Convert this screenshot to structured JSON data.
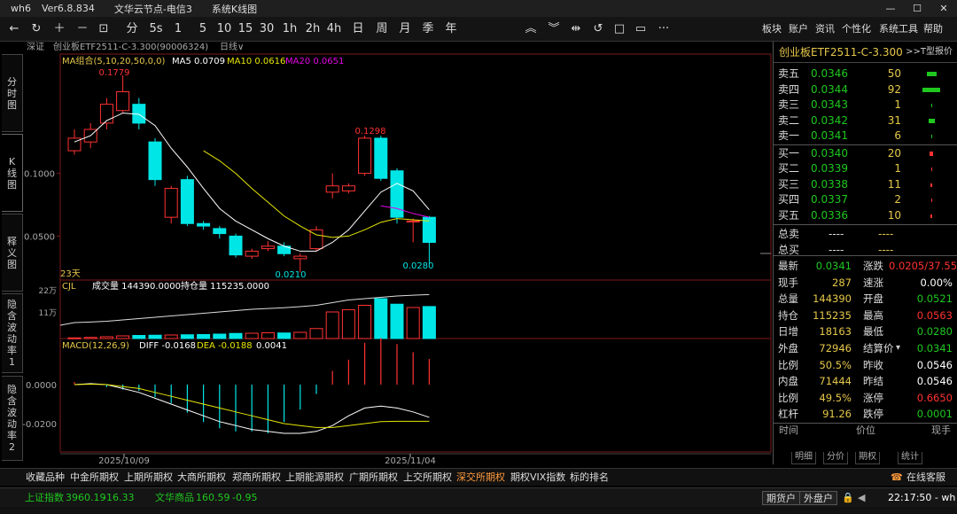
{
  "titlebar": {
    "app": "wh6",
    "version": "Ver6.8.834",
    "node": "文华云节点-电信3",
    "section": "系统K线图"
  },
  "toolbar": {
    "periods": [
      "分",
      "5s",
      "1",
      "5",
      "10",
      "15",
      "30",
      "1h",
      "2h",
      "4h",
      "日",
      "周",
      "月",
      "季",
      "年"
    ],
    "menus": [
      "板块",
      "账户",
      "资讯",
      "个性化",
      "系统工具",
      "帮助"
    ]
  },
  "subheader": {
    "exchange": "深证",
    "instrument": "创业板ETF2511-C-3.300(90006324)",
    "period": "日线"
  },
  "lefttabs": [
    [
      "分",
      "时",
      "图"
    ],
    [
      "K",
      "线",
      "图"
    ],
    [
      "释",
      "义",
      "图"
    ],
    [
      "隐",
      "含",
      "波",
      "动",
      "率",
      "1"
    ],
    [
      "隐",
      "含",
      "波",
      "动",
      "率",
      "2"
    ]
  ],
  "main_chart": {
    "ma_label": "MA组合(5,10,20,50,0,0)",
    "ma5": "MA5 0.0709",
    "ma10": "MA10 0.0616",
    "ma20": "MA20 0.0651",
    "y_ticks": [
      "0.1000",
      "0.0500"
    ],
    "high_label": "0.1779",
    "high2_label": "0.1298",
    "low_label": "0.0210",
    "last_low_label": "0.0280",
    "days_label": "23天",
    "colors": {
      "up": "#ff3232",
      "down": "#00e6e6",
      "ma5": "#ffffff",
      "ma10": "#e6e600",
      "ma20": "#e600e6"
    }
  },
  "volume_chart": {
    "title": "CJL",
    "vol": "成交量 144390.0000",
    "oi": "持仓量 115235.0000",
    "y_ticks": [
      "22万",
      "11万"
    ]
  },
  "macd_chart": {
    "title": "MACD(12,26,9)",
    "diff": "DIFF -0.0168",
    "dea": "DEA -0.0188",
    "macd": "0.0041",
    "y_ticks": [
      "0.0000",
      "-0.0200"
    ],
    "x_dates": [
      "2025/10/09",
      "2025/11/04"
    ]
  },
  "chart_data": {
    "type": "candlestick",
    "title": "创业板ETF2511-C-3.300 日线",
    "series": [
      {
        "name": "candles",
        "values": [
          {
            "o": 0.118,
            "c": 0.128,
            "h": 0.135,
            "l": 0.115
          },
          {
            "o": 0.125,
            "c": 0.135,
            "h": 0.14,
            "l": 0.12
          },
          {
            "o": 0.14,
            "c": 0.155,
            "h": 0.16,
            "l": 0.135
          },
          {
            "o": 0.15,
            "c": 0.165,
            "h": 0.178,
            "l": 0.148
          },
          {
            "o": 0.155,
            "c": 0.14,
            "h": 0.16,
            "l": 0.135
          },
          {
            "o": 0.125,
            "c": 0.095,
            "h": 0.128,
            "l": 0.09
          },
          {
            "o": 0.065,
            "c": 0.088,
            "h": 0.09,
            "l": 0.06
          },
          {
            "o": 0.095,
            "c": 0.06,
            "h": 0.098,
            "l": 0.058
          },
          {
            "o": 0.06,
            "c": 0.058,
            "h": 0.062,
            "l": 0.055
          },
          {
            "o": 0.056,
            "c": 0.052,
            "h": 0.058,
            "l": 0.048
          },
          {
            "o": 0.05,
            "c": 0.035,
            "h": 0.052,
            "l": 0.033
          },
          {
            "o": 0.034,
            "c": 0.038,
            "h": 0.04,
            "l": 0.032
          },
          {
            "o": 0.04,
            "c": 0.042,
            "h": 0.046,
            "l": 0.038
          },
          {
            "o": 0.042,
            "c": 0.036,
            "h": 0.045,
            "l": 0.034
          },
          {
            "o": 0.032,
            "c": 0.034,
            "h": 0.036,
            "l": 0.021
          },
          {
            "o": 0.04,
            "c": 0.055,
            "h": 0.058,
            "l": 0.038
          },
          {
            "o": 0.085,
            "c": 0.09,
            "h": 0.1,
            "l": 0.08
          },
          {
            "o": 0.086,
            "c": 0.09,
            "h": 0.092,
            "l": 0.084
          },
          {
            "o": 0.1,
            "c": 0.128,
            "h": 0.13,
            "l": 0.098
          },
          {
            "o": 0.128,
            "c": 0.096,
            "h": 0.13,
            "l": 0.094
          },
          {
            "o": 0.102,
            "c": 0.065,
            "h": 0.104,
            "l": 0.06
          },
          {
            "o": 0.062,
            "c": 0.062,
            "h": 0.064,
            "l": 0.045
          },
          {
            "o": 0.065,
            "c": 0.045,
            "h": 0.066,
            "l": 0.028
          }
        ]
      },
      {
        "name": "MA5",
        "values": [
          0.125,
          0.13,
          0.142,
          0.148,
          0.147,
          0.138,
          0.12,
          0.105,
          0.088,
          0.072,
          0.062,
          0.055,
          0.048,
          0.042,
          0.038,
          0.038,
          0.045,
          0.055,
          0.07,
          0.085,
          0.092,
          0.086,
          0.071
        ]
      },
      {
        "name": "MA10",
        "values": [
          null,
          null,
          null,
          null,
          null,
          null,
          null,
          null,
          0.118,
          0.11,
          0.1,
          0.088,
          0.077,
          0.066,
          0.058,
          0.051,
          0.049,
          0.05,
          0.055,
          0.061,
          0.064,
          0.063,
          0.062
        ]
      },
      {
        "name": "MA20",
        "values": [
          null,
          null,
          null,
          null,
          null,
          null,
          null,
          null,
          null,
          null,
          null,
          null,
          null,
          null,
          null,
          null,
          null,
          null,
          null,
          0.074,
          0.072,
          0.068,
          0.065
        ]
      }
    ],
    "volume": [
      3000,
      5000,
      8000,
      12000,
      14000,
      15000,
      16000,
      17000,
      18000,
      20000,
      23000,
      24000,
      26000,
      25000,
      28000,
      45000,
      120000,
      130000,
      150000,
      180000,
      155000,
      140000,
      144390
    ],
    "open_interest": [
      10000,
      12000,
      15000,
      20000,
      25000,
      30000,
      35000,
      40000,
      45000,
      50000,
      55000,
      60000,
      63000,
      66000,
      70000,
      75000,
      85000,
      95000,
      100000,
      105000,
      110000,
      113000,
      115235
    ],
    "macd_hist": [
      0.0004,
      0.0002,
      -0.0004,
      -0.0008,
      -0.001,
      -0.002,
      -0.003,
      -0.0045,
      -0.006,
      -0.007,
      -0.0075,
      -0.0075,
      -0.0078,
      -0.006,
      -0.004,
      -0.0015,
      0.0022,
      0.004,
      0.0067,
      0.0075,
      0.0065,
      0.0052,
      0.0041
    ],
    "diff": [
      0.0,
      0.0005,
      0.0,
      -0.002,
      -0.004,
      -0.007,
      -0.01,
      -0.013,
      -0.016,
      -0.019,
      -0.021,
      -0.023,
      -0.024,
      -0.025,
      -0.025,
      -0.024,
      -0.021,
      -0.016,
      -0.012,
      -0.011,
      -0.012,
      -0.014,
      -0.0168
    ],
    "dea": [
      0.0,
      0.0002,
      0.0,
      -0.001,
      -0.002,
      -0.004,
      -0.006,
      -0.008,
      -0.01,
      -0.012,
      -0.014,
      -0.016,
      -0.018,
      -0.02,
      -0.021,
      -0.022,
      -0.022,
      -0.021,
      -0.02,
      -0.019,
      -0.0188,
      -0.0188,
      -0.0188
    ],
    "ylim": [
      0.015,
      0.195
    ]
  },
  "rpanel": {
    "title": "创业板ETF2511-C-3.300",
    "tinfo": ">>T型报价",
    "sells": [
      {
        "lbl": "卖五",
        "pr": "0.0346",
        "vol": "50",
        "w": 11
      },
      {
        "lbl": "卖四",
        "pr": "0.0344",
        "vol": "92",
        "w": 20
      },
      {
        "lbl": "卖三",
        "pr": "0.0343",
        "vol": "1",
        "w": 1
      },
      {
        "lbl": "卖二",
        "pr": "0.0342",
        "vol": "31",
        "w": 7
      },
      {
        "lbl": "卖一",
        "pr": "0.0341",
        "vol": "6",
        "w": 1
      }
    ],
    "buys": [
      {
        "lbl": "买一",
        "pr": "0.0340",
        "vol": "20",
        "w": 4
      },
      {
        "lbl": "买二",
        "pr": "0.0339",
        "vol": "1",
        "w": 1
      },
      {
        "lbl": "买三",
        "pr": "0.0338",
        "vol": "11",
        "w": 2
      },
      {
        "lbl": "买四",
        "pr": "0.0337",
        "vol": "2",
        "w": 1
      },
      {
        "lbl": "买五",
        "pr": "0.0336",
        "vol": "10",
        "w": 2
      }
    ],
    "totals": [
      {
        "lbl": "总卖",
        "v1": "----",
        "v2": "----"
      },
      {
        "lbl": "总买",
        "v1": "----",
        "v2": "----"
      }
    ],
    "quotes": [
      {
        "l1": "最新",
        "v1": "0.0341",
        "c1": "#1ec81e",
        "l2": "涨跌",
        "v2": "0.0205/37.55%",
        "c2": "#ff3232"
      },
      {
        "l1": "现手",
        "v1": "287",
        "c1": "#e6c84a",
        "l2": "速涨",
        "v2": "0.00%",
        "c2": "#fff"
      },
      {
        "l1": "总量",
        "v1": "144390",
        "c1": "#e6c84a",
        "l2": "开盘",
        "v2": "0.0521",
        "c2": "#1ec81e"
      },
      {
        "l1": "持仓",
        "v1": "115235",
        "c1": "#e6c84a",
        "l2": "最高",
        "v2": "0.0563",
        "c2": "#ff3232"
      },
      {
        "l1": "日增",
        "v1": "18163",
        "c1": "#e6c84a",
        "l2": "最低",
        "v2": "0.0280",
        "c2": "#1ec81e"
      },
      {
        "l1": "外盘",
        "v1": "72946",
        "c1": "#e6c84a",
        "l2": "结算价",
        "v2": "0.0341",
        "c2": "#1ec81e"
      },
      {
        "l1": "比例",
        "v1": "50.5%",
        "c1": "#e6c84a",
        "l2": "昨收",
        "v2": "0.0546",
        "c2": "#fff"
      },
      {
        "l1": "内盘",
        "v1": "71444",
        "c1": "#e6c84a",
        "l2": "昨结",
        "v2": "0.0546",
        "c2": "#fff"
      },
      {
        "l1": "比例",
        "v1": "49.5%",
        "c1": "#e6c84a",
        "l2": "涨停",
        "v2": "0.6650",
        "c2": "#ff3232"
      },
      {
        "l1": "杠杆",
        "v1": "91.26",
        "c1": "#e6c84a",
        "l2": "跌停",
        "v2": "0.0001",
        "c2": "#1ec81e"
      }
    ],
    "ticks_hdr": [
      "时间",
      "价位",
      "现手"
    ],
    "tabs": [
      "明细",
      "分价",
      "期权",
      "统计"
    ]
  },
  "bottomtabs": [
    "收藏品种",
    "中金所期权",
    "上期所期权",
    "大商所期权",
    "郑商所期权",
    "上期能源期权",
    "广期所期权",
    "上交所期权",
    "深交所期权",
    "期权VIX指数",
    "标的排名"
  ],
  "bottom_active": "深交所期权",
  "bottom_right": "在线客服",
  "statusbar": {
    "idx1_name": "上证指数",
    "idx1_val": "3960.19",
    "idx1_chg": "-16.33",
    "idx2_name": "文华商品",
    "idx2_val": "160.59",
    "idx2_chg": "-0.95",
    "btn1": "期货户",
    "btn2": "外盘户",
    "time": "22:17:50 - wh"
  }
}
